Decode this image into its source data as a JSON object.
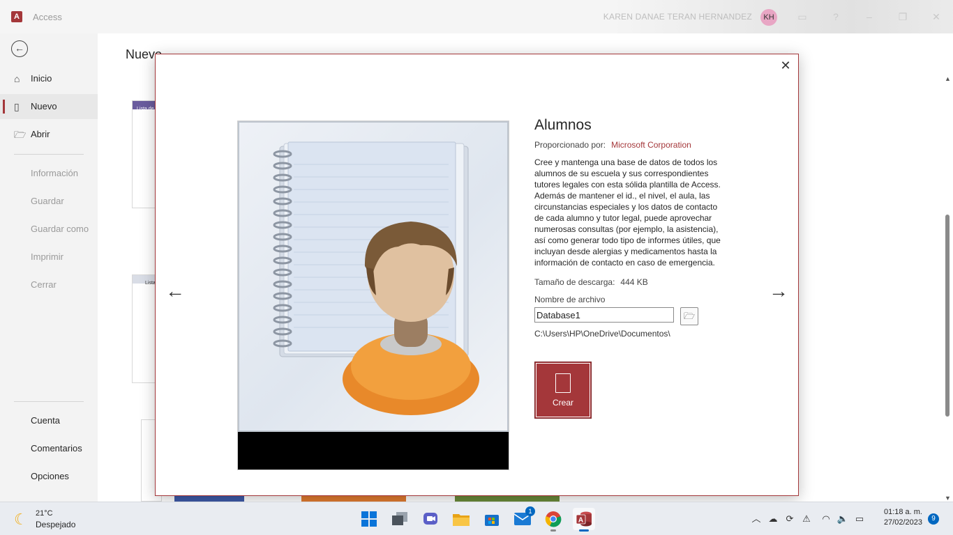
{
  "titlebar": {
    "app_name": "Access",
    "user_name": "KAREN DANAE TERAN HERNANDEZ",
    "avatar_initials": "KH"
  },
  "nav": {
    "items_top": [
      {
        "label": "Inicio",
        "icon": "home-icon"
      },
      {
        "label": "Nuevo",
        "icon": "new-document-icon",
        "active": true
      },
      {
        "label": "Abrir",
        "icon": "folder-open-icon"
      }
    ],
    "items_mid": [
      "Información",
      "Guardar",
      "Guardar como",
      "Imprimir",
      "Cerrar"
    ],
    "items_bottom": [
      "Cuenta",
      "Comentarios",
      "Opciones"
    ]
  },
  "main": {
    "page_title": "Nuevo",
    "thumb1_header": "Lista de",
    "thumb2_header": "Lista"
  },
  "dialog": {
    "title": "Alumnos",
    "provider_label": "Proporcionado por:",
    "provider": "Microsoft Corporation",
    "description": "Cree y mantenga una base de datos de todos los alumnos de su escuela y sus correspondientes tutores legales con esta sólida plantilla de Access. Además de mantener el id., el nivel, el aula, las circunstancias especiales y los datos de contacto de cada alumno y tutor legal, puede aprovechar numerosas consultas (por ejemplo, la asistencia), así como generar todo tipo de informes útiles, que incluyan desde alergias y medicamentos hasta la información de contacto en caso de emergencia.",
    "size_label": "Tamaño de descarga:",
    "size_value": "444 KB",
    "filename_label": "Nombre de archivo",
    "filename_value": "Database1",
    "path": "C:\\Users\\HP\\OneDrive\\Documentos\\",
    "create_label": "Crear"
  },
  "taskbar": {
    "temperature": "21°C",
    "condition": "Despejado",
    "time": "01:18 a. m.",
    "date": "27/02/2023",
    "mail_badge": "1",
    "notifications": "9",
    "apps": [
      "windows-start-icon",
      "task-view-icon",
      "teams-chat-icon",
      "file-explorer-icon",
      "microsoft-store-icon",
      "mail-icon",
      "chrome-icon",
      "access-icon"
    ]
  },
  "colors": {
    "accent": "#a4373a",
    "taskbar_accent": "#0067c0"
  }
}
